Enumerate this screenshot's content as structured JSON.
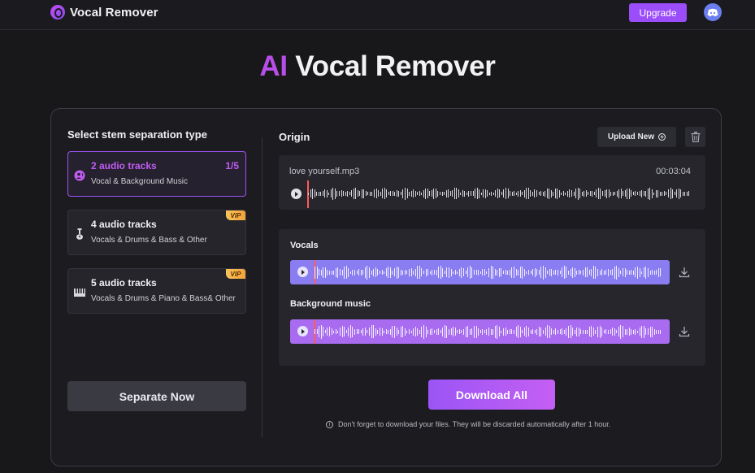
{
  "header": {
    "logo_text": "Vocal Remover",
    "upgrade_label": "Upgrade"
  },
  "headline": {
    "accent": "AI",
    "rest": "Vocal Remover"
  },
  "left_panel": {
    "title": "Select stem separation type",
    "options": [
      {
        "title": "2 audio tracks",
        "subtitle": "Vocal & Background Music",
        "count": "1/5",
        "selected": true
      },
      {
        "title": "4 audio tracks",
        "subtitle": "Vocals & Drums & Bass & Other",
        "badge": "VIP"
      },
      {
        "title": "5 audio tracks",
        "subtitle": "Vocals & Drums & Piano & Bass& Other",
        "badge": "VIP"
      }
    ],
    "separate_label": "Separate Now"
  },
  "right_panel": {
    "origin_label": "Origin",
    "upload_label": "Upload New",
    "file_name": "love yourself.mp3",
    "duration": "00:03:04",
    "stems": [
      {
        "label": "Vocals"
      },
      {
        "label": "Background music"
      }
    ],
    "download_all_label": "Download All",
    "note": "Don't forget to download your files. They will be discarded automatically after 1 hour."
  },
  "colors": {
    "accent": "#b84de8",
    "vocal_bar": "#8a7df2",
    "music_bar": "#a96cf1",
    "playhead": "#ff5a5a"
  }
}
